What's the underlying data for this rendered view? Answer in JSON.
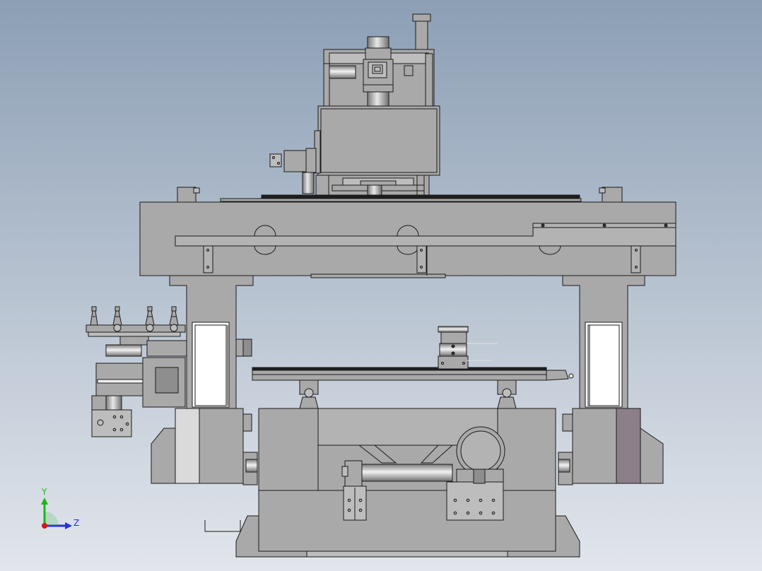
{
  "viewport": {
    "background_top": "#8C9FB5",
    "background_bottom": "#E2E6EC"
  },
  "colors": {
    "part_fill": "#A9A9A9",
    "part_fill_light": "#BDBDBD",
    "part_fill_dark": "#8E8E8E",
    "edge": "#1A1A1A",
    "white_panel": "#FFFFFF",
    "light_panel": "#DADADA",
    "mauve_panel": "#8C7F8A",
    "black_rail": "#1E1E1E"
  },
  "axis_triad": {
    "y_label": "Y",
    "z_label": "Z",
    "y_color": "#1DB51D",
    "z_color": "#2430D8",
    "x_color": "#D01818"
  }
}
